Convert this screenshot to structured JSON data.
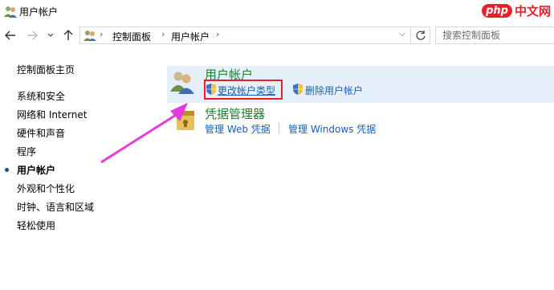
{
  "window": {
    "title": "用户帐户"
  },
  "watermark": {
    "php": "php",
    "cn": "中文网"
  },
  "navigation": {
    "back_icon": "back-arrow-icon",
    "forward_icon": "forward-arrow-icon",
    "recent_icon": "chevron-down-icon",
    "up_icon": "up-arrow-icon",
    "breadcrumbs": [
      "控制面板",
      "用户帐户"
    ],
    "search_placeholder": "搜索控制面板"
  },
  "sidebar": {
    "home": "控制面板主页",
    "items": [
      {
        "label": "系统和安全",
        "active": false
      },
      {
        "label": "网络和 Internet",
        "active": false
      },
      {
        "label": "硬件和声音",
        "active": false
      },
      {
        "label": "程序",
        "active": false
      },
      {
        "label": "用户帐户",
        "active": true
      },
      {
        "label": "外观和个性化",
        "active": false
      },
      {
        "label": "时钟、语言和区域",
        "active": false
      },
      {
        "label": "轻松使用",
        "active": false
      }
    ]
  },
  "sections": [
    {
      "title": "用户帐户",
      "icon": "user-accounts-icon",
      "links": [
        {
          "label": "更改帐户类型",
          "icon": "uac-shield-icon",
          "highlighted": true
        },
        {
          "label": "删除用户帐户",
          "icon": "uac-shield-icon",
          "highlighted": false
        }
      ]
    },
    {
      "title": "凭据管理器",
      "icon": "credential-manager-icon",
      "links": [
        {
          "label": "管理 Web 凭据"
        },
        {
          "label": "管理 Windows 凭据"
        }
      ]
    }
  ],
  "colors": {
    "section_title": "#1e7e2f",
    "link": "#1a5fb4",
    "highlight_panel": "#e6f0fa",
    "annotation_box": "#e8202a",
    "annotation_arrow": "#e43be0"
  }
}
